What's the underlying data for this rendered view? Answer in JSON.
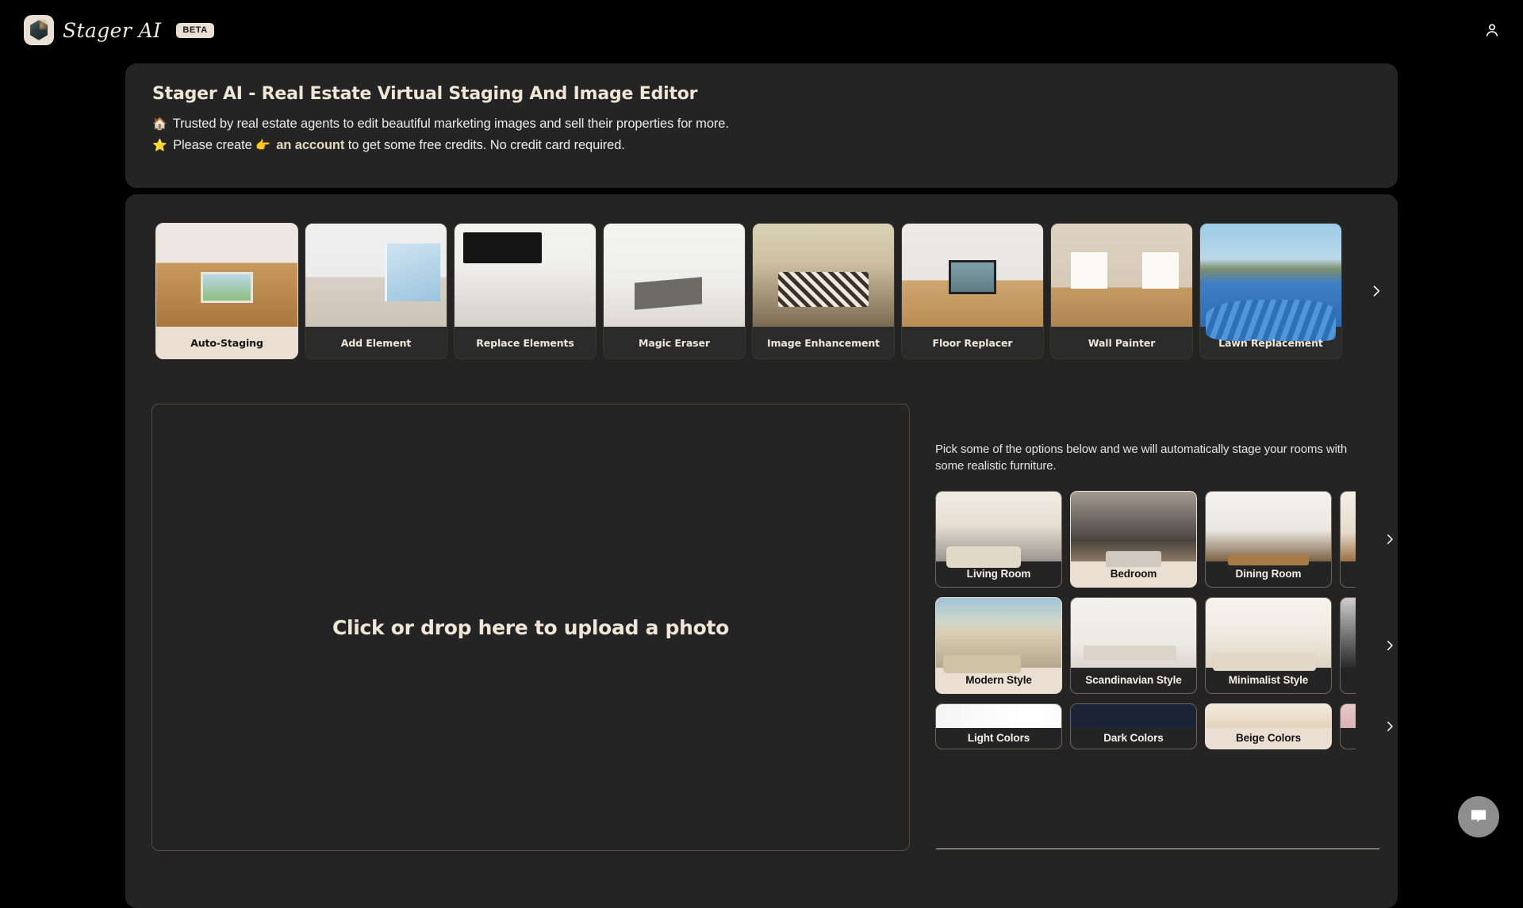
{
  "brand": {
    "name": "Stager AI",
    "badge": "BETA",
    "logo_icon": "gem-logo-icon",
    "accent_cream": "#eadfd2",
    "page_background": "#000000",
    "panel_background": "#242424"
  },
  "topbar": {
    "account_icon": "user-icon"
  },
  "banner": {
    "title": "Stager AI - Real Estate Virtual Staging And Image Editor",
    "line1_emoji": "🏠",
    "line1_text": "Trusted by real estate agents to edit beautiful marketing images and sell their properties for more.",
    "line2_emoji": "⭐",
    "line2_prefix": "Please create",
    "line2_pointer": "👉",
    "line2_link": "an account",
    "line2_suffix": "to get some free credits. No credit card required."
  },
  "tools": {
    "next_icon": "chevron-right-icon",
    "items": [
      {
        "label": "Auto-Staging",
        "selected": true,
        "art": "t-autostaging"
      },
      {
        "label": "Add Element",
        "selected": false,
        "art": "t-addelement"
      },
      {
        "label": "Replace Elements",
        "selected": false,
        "art": "t-replace"
      },
      {
        "label": "Magic Eraser",
        "selected": false,
        "art": "t-magic"
      },
      {
        "label": "Image Enhancement",
        "selected": false,
        "art": "t-enhance"
      },
      {
        "label": "Floor Replacer",
        "selected": false,
        "art": "t-floor"
      },
      {
        "label": "Wall Painter",
        "selected": false,
        "art": "t-wall"
      },
      {
        "label": "Lawn Replacement",
        "selected": false,
        "art": "t-lawn"
      }
    ]
  },
  "dropzone": {
    "text": "Click or drop here to upload a photo"
  },
  "options": {
    "hint": "Pick some of the options below and we will automatically stage your rooms with some realistic furniture.",
    "next_icon": "chevron-right-icon",
    "rooms": [
      {
        "label": "Living Room",
        "selected": false,
        "art": "r-living"
      },
      {
        "label": "Bedroom",
        "selected": true,
        "art": "r-bedroom"
      },
      {
        "label": "Dining Room",
        "selected": false,
        "art": "r-dining"
      },
      {
        "label": "",
        "selected": false,
        "art": "r-partial"
      }
    ],
    "styles": [
      {
        "label": "Modern Style",
        "selected": true,
        "art": "s-modern"
      },
      {
        "label": "Scandinavian Style",
        "selected": false,
        "art": "s-scandi"
      },
      {
        "label": "Minimalist Style",
        "selected": false,
        "art": "s-minimal"
      },
      {
        "label": "",
        "selected": false,
        "art": "s-partial"
      }
    ],
    "colors": [
      {
        "label": "Light Colors",
        "selected": false,
        "art": "c-light"
      },
      {
        "label": "Dark Colors",
        "selected": false,
        "art": "c-dark"
      },
      {
        "label": "Beige Colors",
        "selected": true,
        "art": "c-beige"
      },
      {
        "label": "",
        "selected": false,
        "art": "c-partial"
      }
    ]
  },
  "chat": {
    "icon": "chat-bubble-icon"
  }
}
